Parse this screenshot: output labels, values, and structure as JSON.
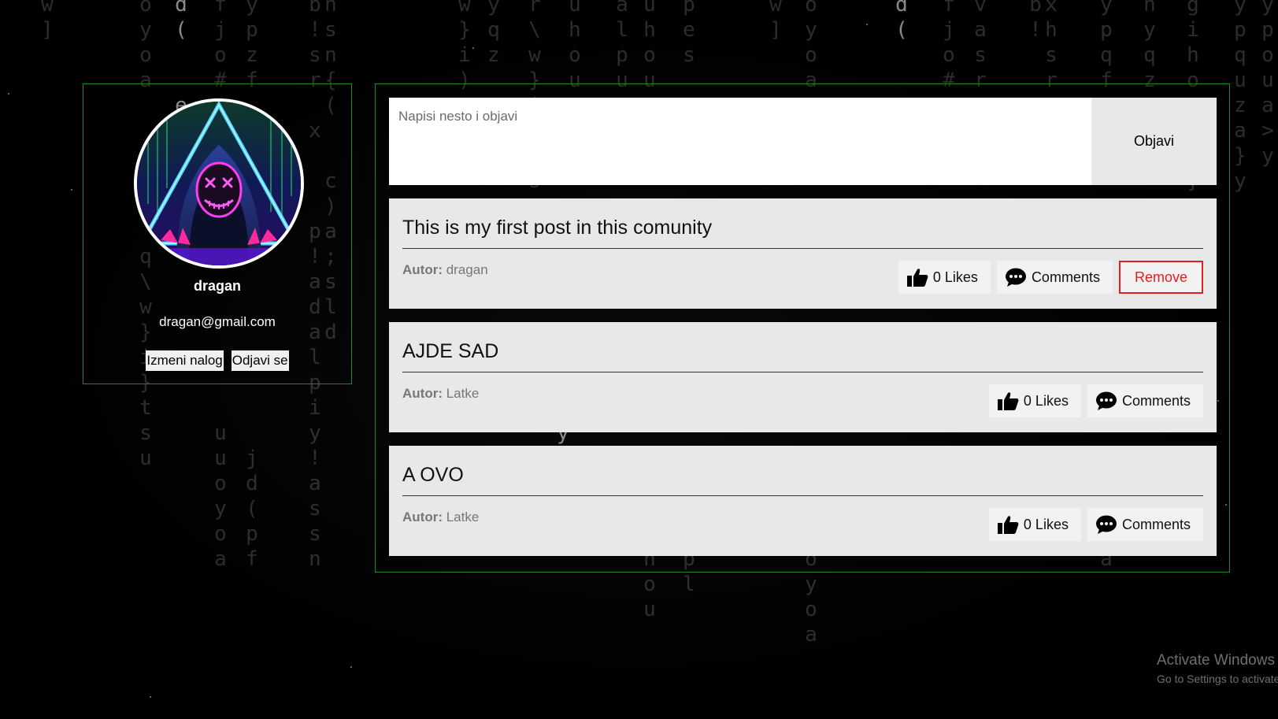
{
  "profile": {
    "username": "dragan",
    "email": "dragan@gmail.com",
    "edit_label": "Izmeni nalog",
    "logout_label": "Odjavi se"
  },
  "composer": {
    "placeholder": "Napisi nesto i objavi",
    "publish_label": "Objavi"
  },
  "posts": [
    {
      "title": "This is my first post in this comunity",
      "author_label": "Autor:",
      "author": "dragan",
      "likes_label": "0 Likes",
      "comments_label": "Comments",
      "remove_label": "Remove"
    },
    {
      "title": "AJDE SAD",
      "author_label": "Autor:",
      "author": "Latke",
      "likes_label": "0 Likes",
      "comments_label": "Comments"
    },
    {
      "title": "A OVO",
      "author_label": "Autor:",
      "author": "Latke",
      "likes_label": "0 Likes",
      "comments_label": "Comments"
    }
  ],
  "watermark": {
    "line1": "Activate Windows",
    "line2": "Go to Settings to activate Windows."
  },
  "colors": {
    "border_green": "#1f8a1f",
    "remove_red": "#dd2222",
    "card_bg": "#e8e8e8"
  },
  "icons": {
    "like": "thumbs-up-icon",
    "comment": "speech-bubble-icon"
  }
}
